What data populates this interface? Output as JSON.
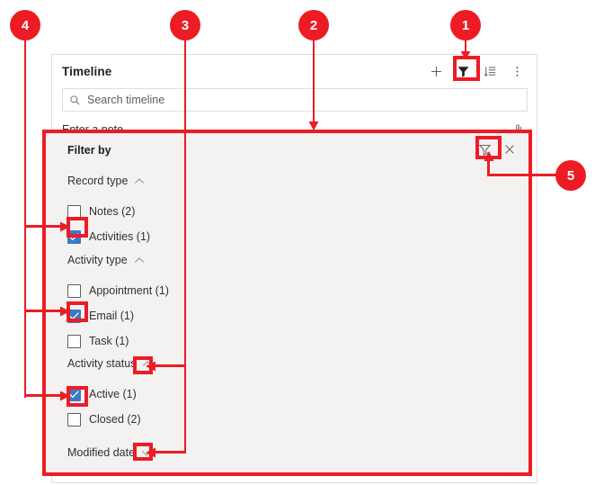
{
  "card": {
    "title": "Timeline",
    "header_actions": [
      {
        "name": "add-icon",
        "label": "Add"
      },
      {
        "name": "filter-icon",
        "label": "Filter"
      },
      {
        "name": "sort-icon",
        "label": "Sort"
      },
      {
        "name": "more-commands-icon",
        "label": "More commands"
      }
    ],
    "search": {
      "placeholder": "Search timeline",
      "value": "",
      "icon": "search-icon"
    },
    "note": {
      "placeholder": "Enter a note...",
      "value": "",
      "attach_icon": "paperclip-icon"
    }
  },
  "filter_panel": {
    "title": "Filter by",
    "tools": [
      {
        "name": "clear-filter-icon",
        "label": "Clear filters"
      },
      {
        "name": "close-icon",
        "label": "Close"
      }
    ],
    "groups": [
      {
        "name": "record-type",
        "label": "Record type",
        "chevron": "chevron-up-icon",
        "expanded": true,
        "options": [
          {
            "label": "Notes (2)",
            "checked": false
          },
          {
            "label": "Activities (1)",
            "checked": true
          }
        ]
      },
      {
        "name": "activity-type",
        "label": "Activity type",
        "chevron": "chevron-up-icon",
        "expanded": true,
        "options": [
          {
            "label": "Appointment (1)",
            "checked": false
          },
          {
            "label": "Email (1)",
            "checked": true
          },
          {
            "label": "Task (1)",
            "checked": false
          }
        ]
      },
      {
        "name": "activity-status",
        "label": "Activity status",
        "chevron": "chevron-up-icon",
        "expanded": true,
        "options": [
          {
            "label": "Active (1)",
            "checked": true
          },
          {
            "label": "Closed (2)",
            "checked": false
          }
        ]
      },
      {
        "name": "modified-date",
        "label": "Modified date",
        "chevron": "chevron-down-icon",
        "expanded": false,
        "options": []
      }
    ]
  },
  "annotations": {
    "accent_color": "#ed1c24",
    "callouts": [
      {
        "number": "1",
        "target": "header-filter-icon"
      },
      {
        "number": "2",
        "target": "filter-panel"
      },
      {
        "number": "3",
        "target": "group-collapse-chevrons"
      },
      {
        "number": "4",
        "target": "selected-checkboxes"
      },
      {
        "number": "5",
        "target": "clear-filter-icon"
      }
    ]
  }
}
